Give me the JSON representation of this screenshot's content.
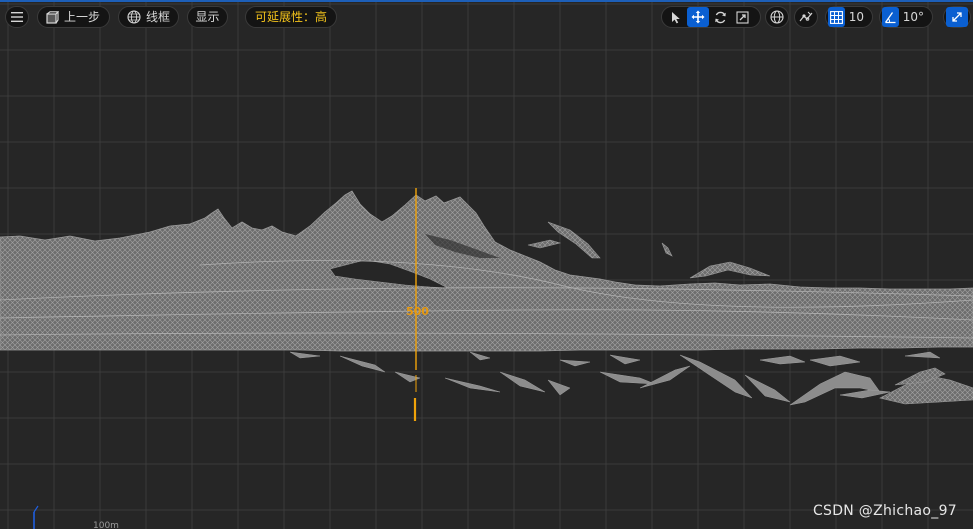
{
  "toolbar": {
    "undo_label": "上一步",
    "wireframe_label": "线框",
    "show_label": "显示",
    "scalability_label": "可延展性：高",
    "grid_snap_value": "10",
    "angle_snap_value": "10°"
  },
  "icons": {
    "menu": "hamburger-icon",
    "undo": "perspective-cube-icon",
    "wireframe": "wireframe-sphere-icon",
    "select": "cursor-arrow-icon",
    "translate": "move-arrows-icon",
    "rotate": "rotate-icon",
    "scale": "scale-icon",
    "world": "globe-icon",
    "surface_snap": "surface-snap-icon",
    "grid_snap": "grid-icon",
    "angle_snap": "angle-icon",
    "camera_speed": "maximize-icon"
  },
  "viewport": {
    "gizmo_value": "500",
    "scale_label": "100m",
    "watermark": "CSDN @Zhichao_97"
  },
  "colors": {
    "background": "#262626",
    "grid_line": "#3b3b3b",
    "mesh": "#8f8f8f",
    "gizmo": "#f0a30a",
    "accent": "#0a5fd1",
    "scalability_text": "#f2c21b"
  }
}
